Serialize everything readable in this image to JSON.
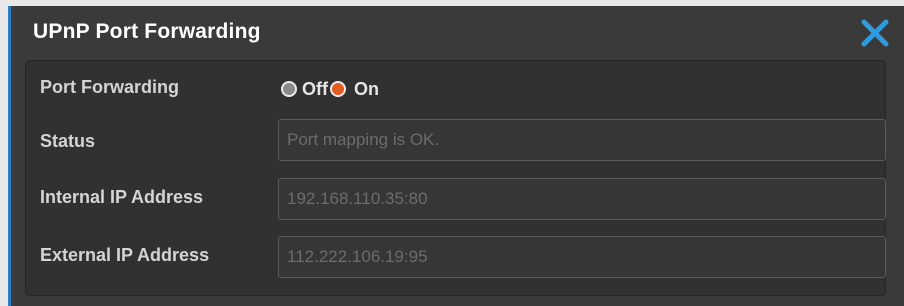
{
  "dialog": {
    "title": "UPnP Port Forwarding",
    "close_icon": "close-icon",
    "accent_color": "#2e9be0"
  },
  "rows": {
    "port_forwarding": {
      "label": "Port Forwarding",
      "options": {
        "off": "Off",
        "on": "On"
      },
      "selected": "On"
    },
    "status": {
      "label": "Status",
      "value": "Port mapping is OK."
    },
    "internal_ip": {
      "label": "Internal IP Address",
      "value": "192.168.110.35:80"
    },
    "external_ip": {
      "label": "External IP Address",
      "value": "112.222.106.19:95"
    }
  }
}
